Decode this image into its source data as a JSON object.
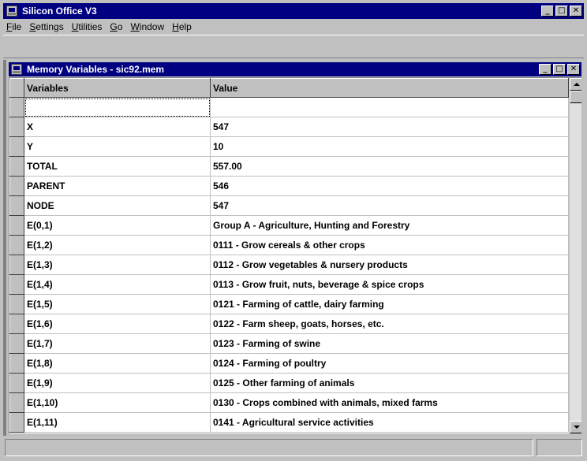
{
  "app": {
    "title": "Silicon Office V3",
    "window_buttons": {
      "minimize": "_",
      "maximize": "□",
      "close": "✕"
    }
  },
  "menu": {
    "items": [
      {
        "label": "File",
        "accel": "F",
        "rest": "ile"
      },
      {
        "label": "Settings",
        "accel": "S",
        "rest": "ettings"
      },
      {
        "label": "Utilities",
        "accel": "U",
        "rest": "tilities"
      },
      {
        "label": "Go",
        "accel": "G",
        "rest": "o"
      },
      {
        "label": "Window",
        "accel": "W",
        "rest": "indow"
      },
      {
        "label": "Help",
        "accel": "H",
        "rest": "elp"
      }
    ]
  },
  "child_window": {
    "title": "Memory Variables - sic92.mem"
  },
  "grid": {
    "columns": [
      "Variables",
      "Value"
    ],
    "rows": [
      {
        "variable": "",
        "value": ""
      },
      {
        "variable": "X",
        "value": "547"
      },
      {
        "variable": "Y",
        "value": "10"
      },
      {
        "variable": "TOTAL",
        "value": "557.00"
      },
      {
        "variable": "PARENT",
        "value": "546"
      },
      {
        "variable": "NODE",
        "value": "547"
      },
      {
        "variable": "E(0,1)",
        "value": "Group A - Agriculture, Hunting and Forestry"
      },
      {
        "variable": "E(1,2)",
        "value": "0111 - Grow cereals & other crops"
      },
      {
        "variable": "E(1,3)",
        "value": "0112 - Grow vegetables & nursery products"
      },
      {
        "variable": "E(1,4)",
        "value": "0113 - Grow fruit, nuts, beverage & spice crops"
      },
      {
        "variable": "E(1,5)",
        "value": "0121 - Farming of cattle, dairy farming"
      },
      {
        "variable": "E(1,6)",
        "value": "0122 - Farm sheep, goats, horses, etc."
      },
      {
        "variable": "E(1,7)",
        "value": "0123 - Farming of swine"
      },
      {
        "variable": "E(1,8)",
        "value": "0124 - Farming of poultry"
      },
      {
        "variable": "E(1,9)",
        "value": "0125 - Other farming of animals"
      },
      {
        "variable": "E(1,10)",
        "value": "0130 - Crops combined with animals, mixed farms"
      },
      {
        "variable": "E(1,11)",
        "value": "0141 - Agricultural service activities"
      }
    ]
  },
  "colors": {
    "titlebar": "#000080",
    "face": "#c0c0c0",
    "workspace": "#808080"
  }
}
